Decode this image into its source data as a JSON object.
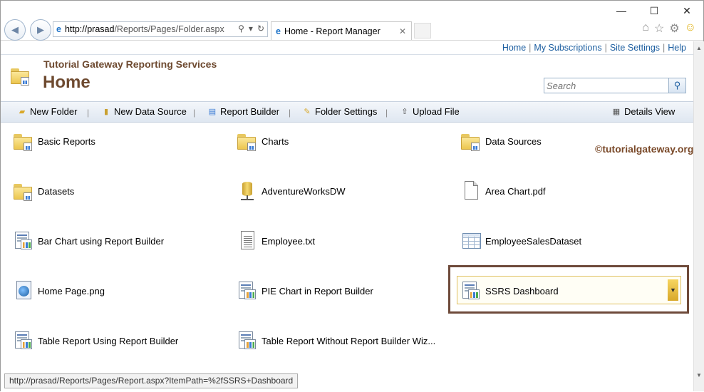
{
  "browser": {
    "window_controls": {
      "minimize": "—",
      "maximize": "☐",
      "close": "✕"
    },
    "address_url_host": "http://prasad",
    "address_url_path": "/Reports/Pages/Folder.aspx",
    "tab_title": "Home - Report Manager"
  },
  "top_links": [
    "Home",
    "My Subscriptions",
    "Site Settings",
    "Help"
  ],
  "header": {
    "site_title": "Tutorial Gateway Reporting Services",
    "page_title": "Home",
    "search_placeholder": "Search"
  },
  "toolbar": {
    "new_folder": "New Folder",
    "new_data_source": "New Data Source",
    "report_builder": "Report Builder",
    "folder_settings": "Folder Settings",
    "upload_file": "Upload File",
    "details_view": "Details View"
  },
  "items": [
    {
      "label": "Basic Reports",
      "type": "folder"
    },
    {
      "label": "Charts",
      "type": "folder"
    },
    {
      "label": "Data Sources",
      "type": "folder"
    },
    {
      "label": "Datasets",
      "type": "folder"
    },
    {
      "label": "AdventureWorksDW",
      "type": "datasource"
    },
    {
      "label": "Area Chart.pdf",
      "type": "file"
    },
    {
      "label": "Bar Chart using Report Builder",
      "type": "report"
    },
    {
      "label": "Employee.txt",
      "type": "text"
    },
    {
      "label": "EmployeeSalesDataset",
      "type": "dataset"
    },
    {
      "label": "Home Page.png",
      "type": "image"
    },
    {
      "label": "PIE Chart in Report Builder",
      "type": "report"
    },
    {
      "label": "SSRS Dashboard",
      "type": "report",
      "selected": true
    },
    {
      "label": "Table Report Using Report Builder",
      "type": "report"
    },
    {
      "label": "Table Report Without Report Builder Wiz...",
      "type": "report"
    }
  ],
  "watermark": "©tutorialgateway.org",
  "status_url": "http://prasad/Reports/Pages/Report.aspx?ItemPath=%2fSSRS+Dashboard"
}
